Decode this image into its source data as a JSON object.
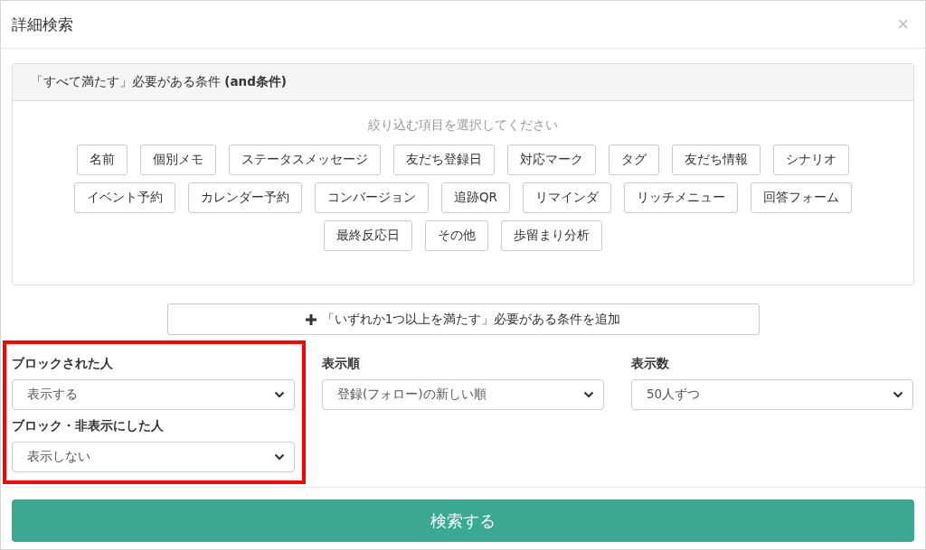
{
  "dialog": {
    "title": "詳細検索",
    "close": "×"
  },
  "and_panel": {
    "title": "「すべて満たす」必要がある条件 **(and条件)**",
    "hint": "絞り込む項目を選択してください",
    "chip_rows": [
      [
        "名前",
        "個別メモ",
        "ステータスメッセージ",
        "友だち登録日",
        "対応マーク",
        "タグ",
        "友だち情報",
        "シナリオ"
      ],
      [
        "イベント予約",
        "カレンダー予約",
        "コンバージョン",
        "追跡QR",
        "リマインダ",
        "リッチメニュー",
        "回答フォーム"
      ],
      [
        "最終反応日",
        "その他",
        "歩留まり分析"
      ]
    ]
  },
  "add_button": "「いずれか1つ以上を満たす」必要がある条件を追加",
  "columns": [
    {
      "highlighted": true,
      "fields": [
        {
          "label": "ブロックされた人",
          "value": "表示する"
        },
        {
          "label": "ブロック・非表示にした人",
          "value": "表示しない"
        }
      ]
    },
    {
      "highlighted": false,
      "fields": [
        {
          "label": "表示順",
          "value": "登録(フォロー)の新しい順"
        }
      ]
    },
    {
      "highlighted": false,
      "fields": [
        {
          "label": "表示数",
          "value": "50人ずつ"
        }
      ]
    }
  ],
  "search_button": "検索する"
}
